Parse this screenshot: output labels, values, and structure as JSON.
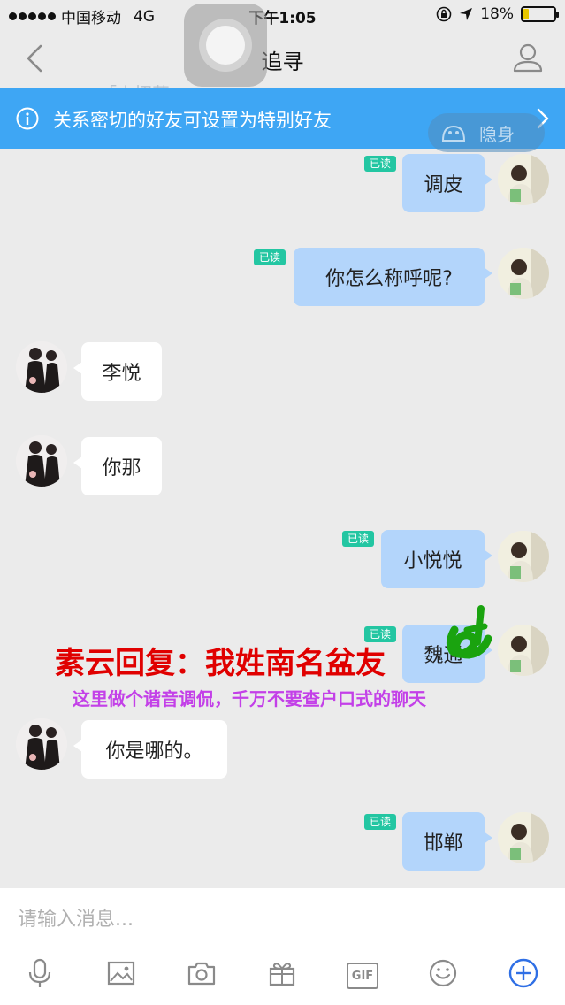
{
  "status_bar": {
    "carrier": "中国移动",
    "network": "4G",
    "time": "下午1:05",
    "battery_percent_text": "18%",
    "battery_level": 0.18
  },
  "nav": {
    "title": "追寻",
    "back_icon": "chevron-left-icon",
    "profile_icon": "person-icon"
  },
  "ghost_header": "「小招募」",
  "notice": {
    "text": "关系密切的好友可设置为特别好友",
    "stealth_label": "隐身"
  },
  "messages": [
    {
      "side": "self",
      "text": "调皮",
      "read_label": "已读"
    },
    {
      "side": "self",
      "text": "你怎么称呼呢?",
      "read_label": "已读"
    },
    {
      "side": "other",
      "text": "李悦"
    },
    {
      "side": "other",
      "text": "你那"
    },
    {
      "side": "self",
      "text": "小悦悦",
      "read_label": "已读"
    },
    {
      "side": "self",
      "text": "魏通",
      "read_label": "已读"
    },
    {
      "side": "other",
      "text": "你是哪的。"
    },
    {
      "side": "self",
      "text": "邯郸",
      "read_label": "已读"
    }
  ],
  "overlay": {
    "headline": "素云回复：我姓南名盆友",
    "subline": "这里做个谐音调侃，千万不要查户口式的聊天",
    "headline_color": "#e00000",
    "subline_color": "#c340e8"
  },
  "input": {
    "placeholder": "请输入消息..."
  },
  "toolbar": {
    "icons": [
      "microphone-icon",
      "image-icon",
      "camera-icon",
      "gift-icon",
      "gif-icon",
      "emoji-icon",
      "add-icon"
    ],
    "gif_label": "GIF"
  },
  "colors": {
    "accent": "#3ea6f4",
    "self_bubble": "#b3d5fb",
    "read_badge": "#23c6a2"
  }
}
